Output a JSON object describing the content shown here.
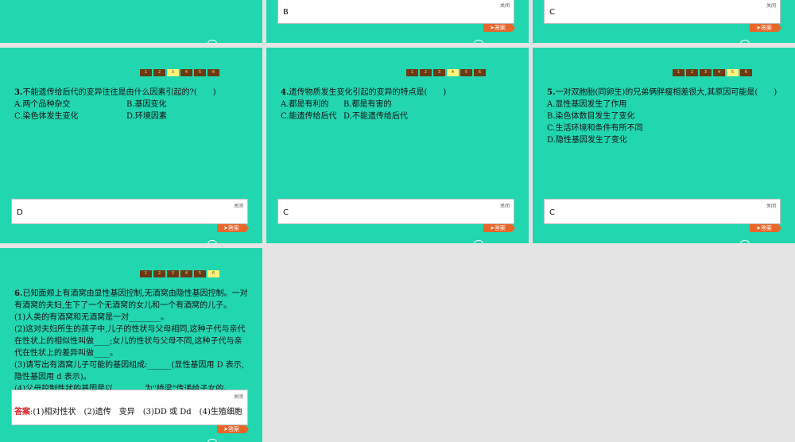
{
  "nav_labels": [
    "1",
    "2",
    "3",
    "4",
    "5",
    "6"
  ],
  "close_label": "关闭",
  "answer_button": "答案",
  "top_left": {},
  "top_mid": {
    "answer": "B"
  },
  "top_right": {
    "answer": "C"
  },
  "q3": {
    "num": "3.",
    "stem": "不能遗传给后代的变异往往是由什么因素引起的?(　　)",
    "a": "A.两个品种杂交",
    "b": "B.基因变化",
    "c": "C.染色体发生变化",
    "d": "D.环境因素",
    "answer": "D"
  },
  "q4": {
    "num": "4.",
    "stem": "遗传物质发生变化引起的变异的特点是(　　)",
    "a": "A.都是有利的",
    "b": "B.都是有害的",
    "c": "C.能遗传给后代",
    "d": "D.不能遗传给后代",
    "answer": "C"
  },
  "q5": {
    "num": "5.",
    "stem": "一对双胞胎(同卵生)的兄弟俩胖瘦相差很大,其原因可能是(　　)",
    "a": "A.显性基因发生了作用",
    "b": "B.染色体数目发生了变化",
    "c": "C.生活环境和条件有所不同",
    "d": "D.隐性基因发生了变化",
    "answer": "C"
  },
  "q6": {
    "num": "6.",
    "line1": "已知面颊上有酒窝由显性基因控制,无酒窝由隐性基因控制。一对",
    "line2": "有酒窝的夫妇,生下了一个无酒窝的女儿和一个有酒窝的儿子。",
    "line3": "(1)人类的有酒窝和无酒窝是一对________。",
    "line4": "(2)这对夫妇所生的孩子中,儿子的性状与父母相同,这种子代与亲代",
    "line5": "在性状上的相似性叫做____;女儿的性状与父母不同,这种子代与亲",
    "line6": "代在性状上的差异叫做____。",
    "line7": "(3)请写出有酒窝儿子可能的基因组成:______(显性基因用 D 表示,",
    "line8": "隐性基因用 d 表示)。",
    "line9": "(4)父母控制性状的基因是以________为\"桥梁\"传递给子女的。",
    "answer_label": "答案",
    "answer_text": ":(1)相对性状　(2)遗传　变异　(3)DD 或 Dd　(4)生殖细胞"
  }
}
